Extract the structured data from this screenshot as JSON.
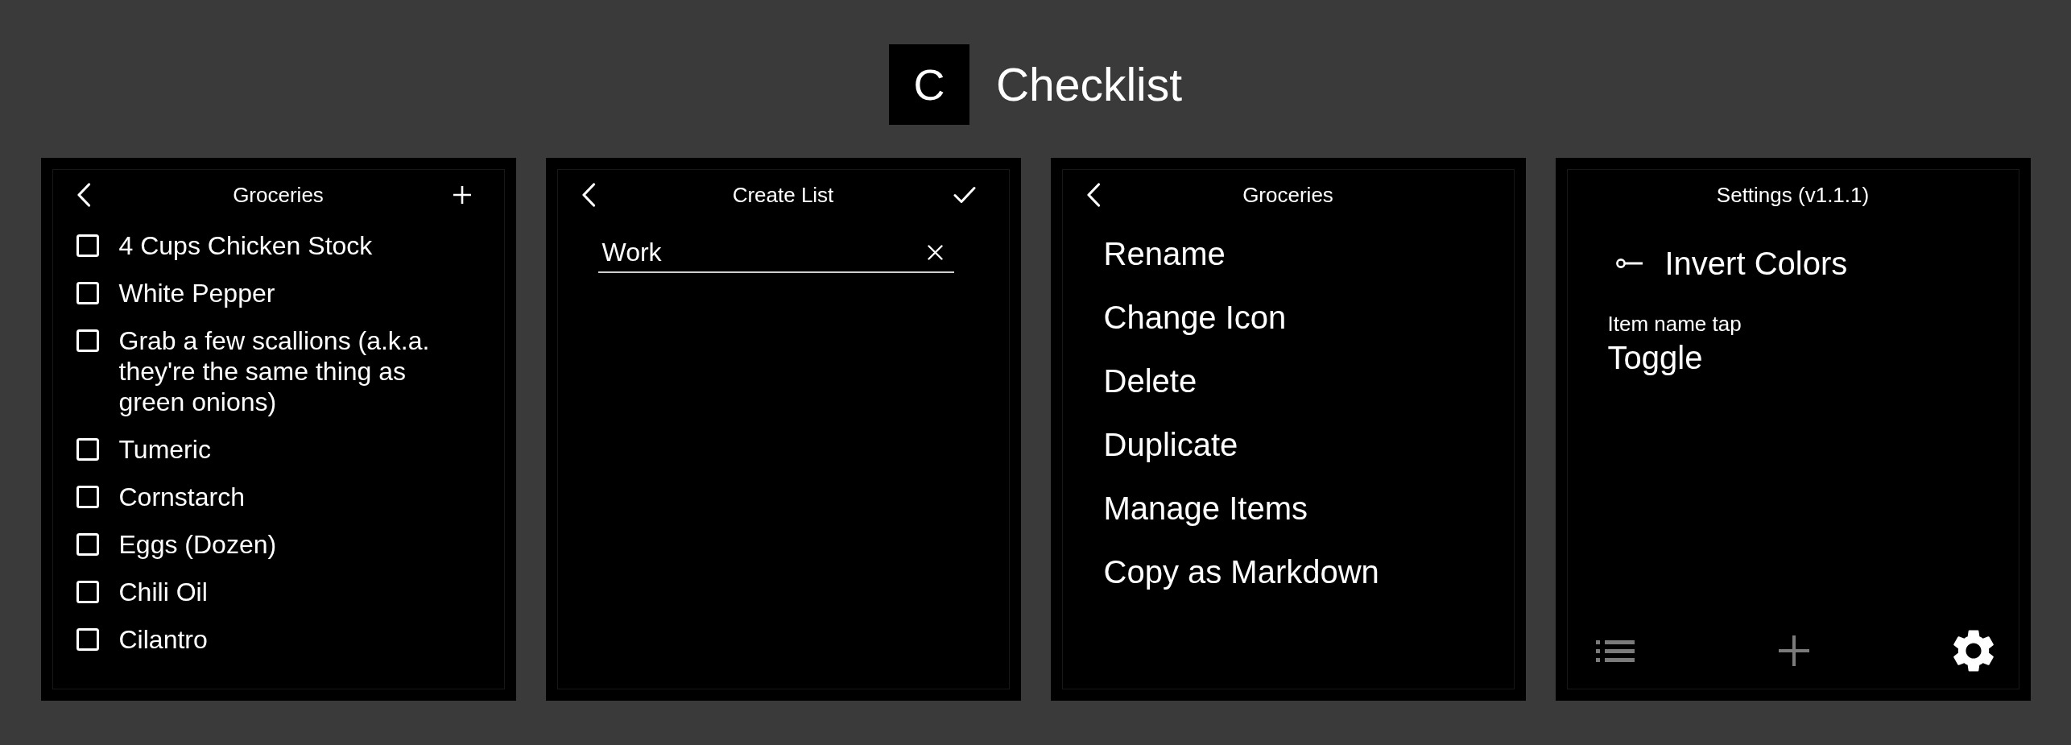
{
  "app": {
    "logo": "C",
    "title": "Checklist"
  },
  "screens": [
    {
      "kind": "checklist",
      "header": {
        "back": true,
        "title": "Groceries",
        "actions": [
          {
            "kind": "add"
          }
        ]
      },
      "items": [
        {
          "text": "4 Cups Chicken Stock",
          "checked": false
        },
        {
          "text": "White Pepper",
          "checked": false
        },
        {
          "text": "Grab a few scallions (a.k.a. they're the same thing as green onions)",
          "checked": false
        },
        {
          "text": "Tumeric",
          "checked": false
        },
        {
          "text": "Cornstarch",
          "checked": false
        },
        {
          "text": "Eggs (Dozen)",
          "checked": false
        },
        {
          "text": "Chili Oil",
          "checked": false
        },
        {
          "text": "Cilantro",
          "checked": false
        }
      ]
    },
    {
      "kind": "create_list",
      "header": {
        "back": true,
        "title": "Create List",
        "actions": [
          {
            "kind": "confirm"
          }
        ]
      },
      "field": {
        "value": "Work"
      }
    },
    {
      "kind": "list_menu",
      "header": {
        "back": true,
        "title": "Groceries"
      },
      "options": [
        "Rename",
        "Change Icon",
        "Delete",
        "Duplicate",
        "Manage Items",
        "Copy as Markdown"
      ]
    },
    {
      "kind": "settings",
      "header": {
        "back": false,
        "title": "Settings (v1.1.1)"
      },
      "toggles": [
        {
          "label": "Invert Colors",
          "on": false
        }
      ],
      "choices": [
        {
          "label": "Item name tap",
          "value": "Toggle"
        }
      ],
      "nav": [
        {
          "kind": "lists",
          "selected": false
        },
        {
          "kind": "add",
          "selected": false
        },
        {
          "kind": "settings",
          "selected": true
        }
      ]
    }
  ]
}
